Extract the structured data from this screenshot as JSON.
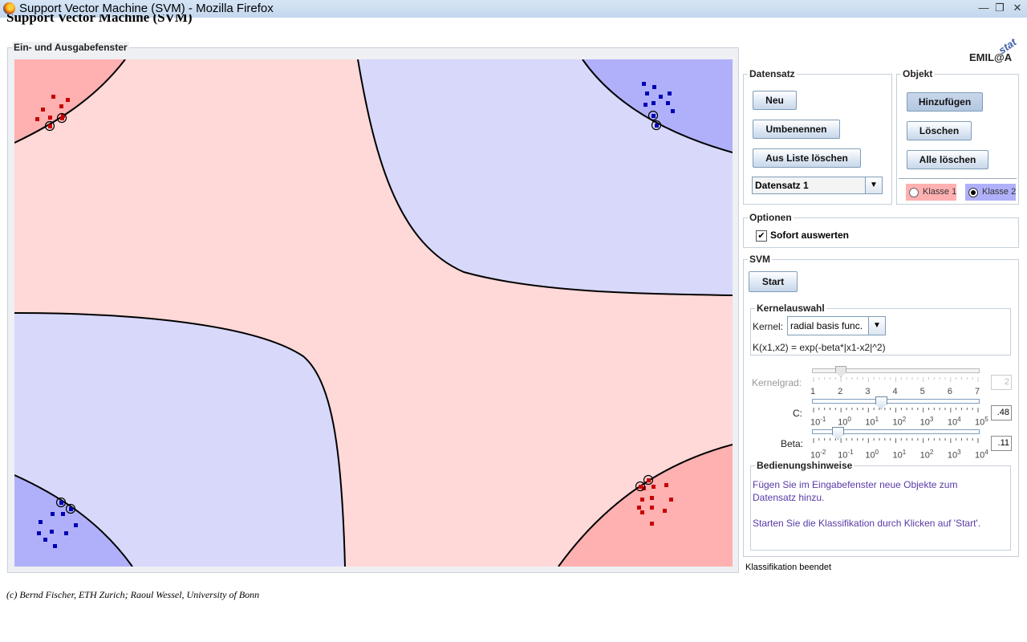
{
  "window": {
    "title": "Support Vector Machine (SVM) - Mozilla Firefox",
    "page_heading": "Support Vector Machine (SVM)"
  },
  "canvas_panel": {
    "label": "Ein- und Ausgabefenster"
  },
  "logo": {
    "text": "EMIL@A",
    "accent": "stat"
  },
  "datensatz": {
    "label": "Datensatz",
    "new_button": "Neu",
    "rename_button": "Umbenennen",
    "remove_button": "Aus Liste löschen",
    "selected": "Datensatz 1"
  },
  "objekt": {
    "label": "Objekt",
    "add_button": "Hinzufügen",
    "delete_button": "Löschen",
    "delete_all_button": "Alle löschen",
    "class1_label": "Klasse 1",
    "class2_label": "Klasse 2",
    "selected_class": "Klasse 2"
  },
  "optionen": {
    "label": "Optionen",
    "instant_label": "Sofort auswerten",
    "instant_checked": true
  },
  "svm": {
    "label": "SVM",
    "start_button": "Start",
    "kernel_group_label": "Kernelauswahl",
    "kernel_label": "Kernel:",
    "kernel_value": "radial basis func.",
    "formula": "K(x1,x2) = exp(-beta*|x1-x2|^2)",
    "kernelgrad": {
      "label": "Kernelgrad:",
      "value": "2",
      "ticks": [
        "1",
        "2",
        "3",
        "4",
        "5",
        "6",
        "7"
      ],
      "enabled": false
    },
    "c": {
      "label": "C:",
      "value": ".48",
      "ticks": [
        [
          "10",
          "-1"
        ],
        [
          "10",
          "0"
        ],
        [
          "10",
          "1"
        ],
        [
          "10",
          "2"
        ],
        [
          "10",
          "3"
        ],
        [
          "10",
          "4"
        ],
        [
          "10",
          "5"
        ]
      ]
    },
    "beta": {
      "label": "Beta:",
      "value": ".11",
      "ticks": [
        [
          "10",
          "-2"
        ],
        [
          "10",
          "-1"
        ],
        [
          "10",
          "0"
        ],
        [
          "10",
          "1"
        ],
        [
          "10",
          "2"
        ],
        [
          "10",
          "3"
        ],
        [
          "10",
          "4"
        ]
      ]
    }
  },
  "hints": {
    "label": "Bedienungshinweise",
    "line1": "Fügen Sie im Eingabefenster neue Objekte zum Datensatz hinzu.",
    "line2": "Starten Sie die Klassifikation durch Klicken auf 'Start'."
  },
  "status": {
    "text": "Klassifikation beendet"
  },
  "footer": {
    "copyright": "(c) Bernd Fischer, ETH Zurich; Raoul Wessel, University of Bonn"
  },
  "colors": {
    "class1": "#c80000",
    "class2": "#0000b4",
    "region1": "#ffd8d8",
    "region2": "#d8d8fb",
    "margin1": "#ffb0b0",
    "margin2": "#b0b0fa",
    "accent": "#3c5fa8"
  }
}
